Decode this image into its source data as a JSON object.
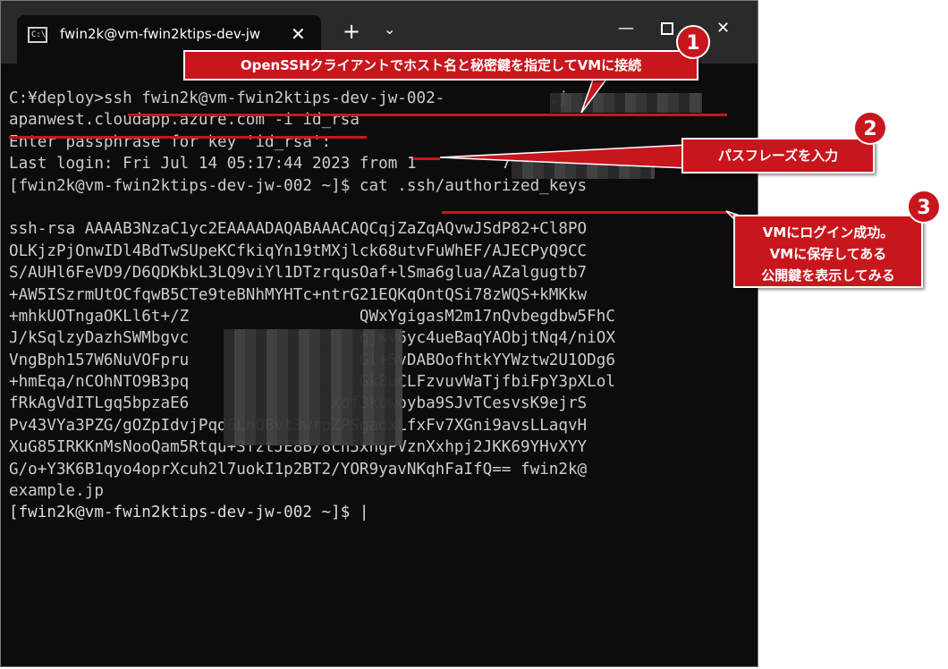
{
  "window": {
    "tab_title": "fwin2k@vm-fwin2ktips-dev-jw",
    "tab_icon_text": "C:\\",
    "new_tab": "+",
    "dropdown": "⌄",
    "close_tab": "✕",
    "minimize": "—",
    "close": "✕"
  },
  "terminal": {
    "lines": [
      "C:¥deploy>ssh fwin2k@vm-fwin2ktips-dev-jw-002-           .j",
      "apanwest.cloudapp.azure.com -i id_rsa",
      "Enter passphrase for key 'id_rsa':",
      "Last login: Fri Jul 14 05:17:44 2023 from 1         7",
      "[fwin2k@vm-fwin2ktips-dev-jw-002 ~]$ cat .ssh/authorized_keys",
      "",
      "ssh-rsa AAAAB3NzaC1yc2EAAAADAQABAAACAQCqjZaZqAQvwJSdP82+Cl8PO",
      "OLKjzPjOnwIDl4BdTwSUpeKCfkiqYn19tMXjlck68utvFuWhEF/AJECPyQ9CC",
      "S/AUHl6FeVD9/D6QDKbkL3LQ9viYl1DTzrqusOaf+lSma6glua/AZalgugtb7",
      "+AW5ISzrmUtOCfqwB5CTe9teBNhMYHTc+ntrG21EQKqOntQSi78zWQS+kMKkw",
      "+mhkUOTngaOKLl6t+/Z                  QWxYgigasM2m17nQvbegdbw5FhC",
      "J/kSqlzyDazhSWMbgvc                  qjwv6yc4ueBaqYAObjtNq4/niOX",
      "VngBph157W6NuVOFpru                  Gl+5vDABOofhtkYYWztw2U1ODg6",
      "+hmEqa/nCOhNTO9B3pq                  Gk8uCLFzvuvWaTjfbiFpY3pXLol",
      "fRkAgVdITLgq5bpzaE6               xof3kuwoyba9SJvTCesvsK9ejrS",
      "Pv43VYa3PZG/gOZpIdvjPqd6LnQ8vt3wrpZPSgadxLfxFv7XGni9avsLLaqvH",
      "XuG85IRKKnMsNooQam5Rtqu+3fztJE8B/8ch5xhgPVznXxhpj2JKK69YHvXYY",
      "G/o+Y3K6B1qyo4oprXcuh2l7uokI1p2BT2/YOR9yavNKqhFaIfQ== fwin2k@",
      "example.jp",
      "[fwin2k@vm-fwin2ktips-dev-jw-002 ~]$ |"
    ]
  },
  "annotations": [
    {
      "number": "1",
      "text": "OpenSSHクライアントでホスト名と秘密鍵を指定してVMに接続"
    },
    {
      "number": "2",
      "text": "パスフレーズを入力"
    },
    {
      "number": "3",
      "line1": "VMにログイン成功。",
      "line2": "VMに保存してある",
      "line3": "公開鍵を表示してみる"
    }
  ],
  "colors": {
    "accent": "#c8161d",
    "terminal_bg": "#0c0c0c",
    "terminal_text": "#cccccc",
    "titlebar_bg": "#2a2a2a"
  }
}
